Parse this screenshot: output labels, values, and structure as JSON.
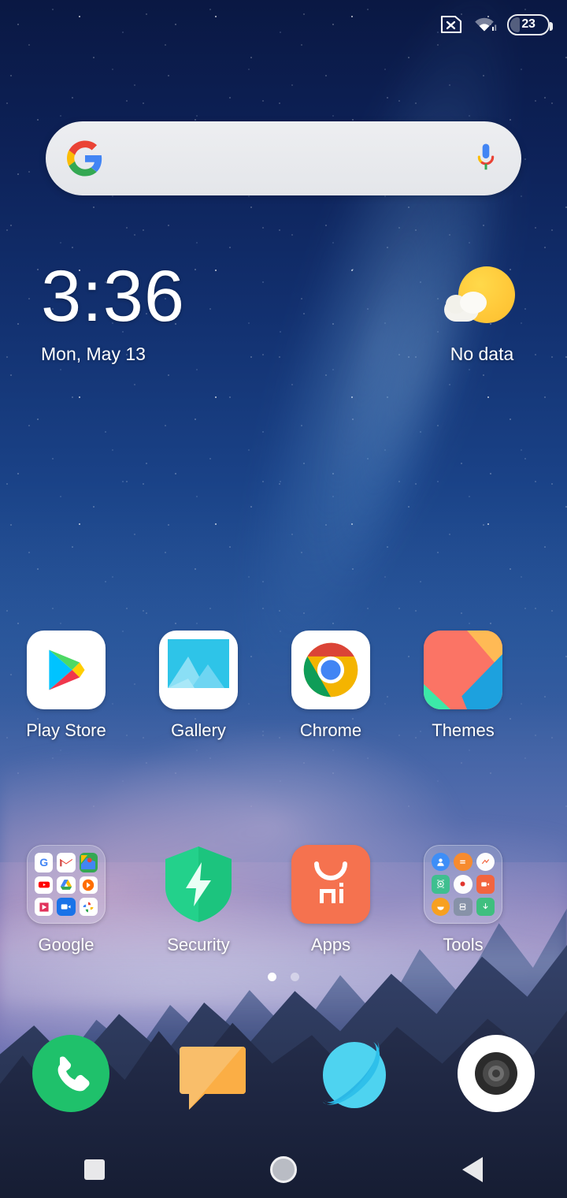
{
  "status_bar": {
    "sim_icon": "sim-card-no-service-icon",
    "wifi_icon": "wifi-icon",
    "battery_icon": "battery-icon",
    "battery_level": "23"
  },
  "search_widget": {
    "google_logo": "google-g-logo-icon",
    "mic_icon": "microphone-icon",
    "query": "",
    "placeholder": ""
  },
  "clock_widget": {
    "time": "3:36",
    "date": "Mon, May 13"
  },
  "weather_widget": {
    "icon": "sun-behind-cloud-icon",
    "status": "No data"
  },
  "app_grid": {
    "row1": [
      {
        "label": "Play Store",
        "icon": "play-store-icon"
      },
      {
        "label": "Gallery",
        "icon": "gallery-icon"
      },
      {
        "label": "Chrome",
        "icon": "chrome-icon"
      },
      {
        "label": "Themes",
        "icon": "themes-icon"
      }
    ],
    "row2": [
      {
        "label": "Google",
        "icon": "google-folder-icon"
      },
      {
        "label": "Security",
        "icon": "security-shield-icon"
      },
      {
        "label": "Apps",
        "icon": "mi-apps-store-icon"
      },
      {
        "label": "Tools",
        "icon": "tools-folder-icon"
      }
    ],
    "google_folder_apps": [
      "google-search-icon",
      "gmail-icon",
      "maps-icon",
      "youtube-icon",
      "drive-icon",
      "play-music-icon",
      "play-movies-icon",
      "duo-icon",
      "photos-icon"
    ],
    "tools_folder_apps": [
      "contacts-icon",
      "calculator-icon",
      "compass-icon",
      "scanner-icon",
      "recorder-icon",
      "video-icon",
      "weather-icon",
      "notes-icon",
      "downloads-icon"
    ]
  },
  "page_indicator": {
    "total": 2,
    "active": 1
  },
  "dock": [
    {
      "label": "Phone",
      "icon": "phone-icon"
    },
    {
      "label": "Messaging",
      "icon": "messages-icon"
    },
    {
      "label": "Browser",
      "icon": "browser-icon"
    },
    {
      "label": "Camera",
      "icon": "camera-icon"
    }
  ],
  "nav_bar": [
    {
      "label": "Recents",
      "icon": "recents-square-icon"
    },
    {
      "label": "Home",
      "icon": "home-circle-icon"
    },
    {
      "label": "Back",
      "icon": "back-triangle-icon"
    }
  ],
  "colors": {
    "sky_top": "#0a1843",
    "sky_mid": "#2a5a9e",
    "cloud_purple": "#9b84bd",
    "mountain_dark": "#161d33",
    "accent_green": "#1fc16b",
    "accent_orange": "#f2653f",
    "search_bar": "#e8e9ec"
  }
}
